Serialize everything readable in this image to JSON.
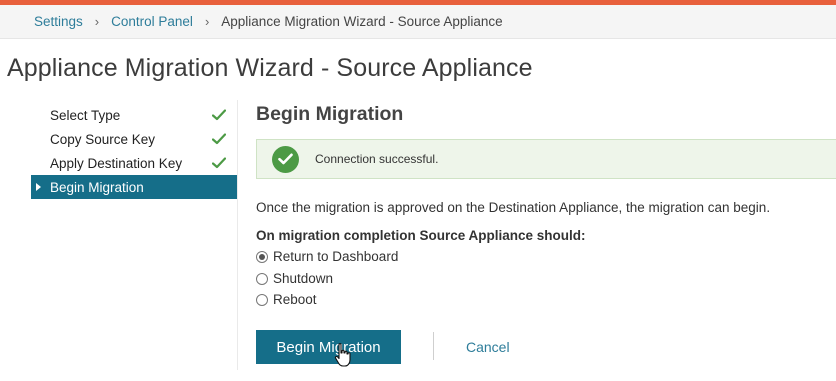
{
  "breadcrumb": {
    "items": [
      "Settings",
      "Control Panel"
    ],
    "separator": "›",
    "current": "Appliance Migration Wizard - Source Appliance"
  },
  "page": {
    "title": "Appliance Migration Wizard - Source Appliance"
  },
  "steps": [
    {
      "label": "Select Type",
      "status": "complete",
      "icon": "check-icon"
    },
    {
      "label": "Copy Source Key",
      "status": "complete",
      "icon": "check-icon"
    },
    {
      "label": "Apply Destination Key",
      "status": "complete",
      "icon": "check-icon"
    },
    {
      "label": "Begin Migration",
      "status": "active"
    }
  ],
  "main": {
    "section_title": "Begin Migration",
    "alert": {
      "icon": "check-circle-icon",
      "text": "Connection successful."
    },
    "info_text": "Once the migration is approved on the Destination Appliance, the migration can begin.",
    "completion_label": "On migration completion Source Appliance should:",
    "options": [
      {
        "label": "Return to Dashboard",
        "selected": true
      },
      {
        "label": "Shutdown",
        "selected": false
      },
      {
        "label": "Reboot",
        "selected": false
      }
    ],
    "buttons": {
      "begin": "Begin Migration",
      "cancel": "Cancel"
    }
  },
  "colors": {
    "accent": "#156e89",
    "link": "#2e7d9a",
    "success": "#4c9a45",
    "success_bg": "#eef5ea",
    "top_bar": "#e8603c",
    "check": "#4c9a45"
  }
}
